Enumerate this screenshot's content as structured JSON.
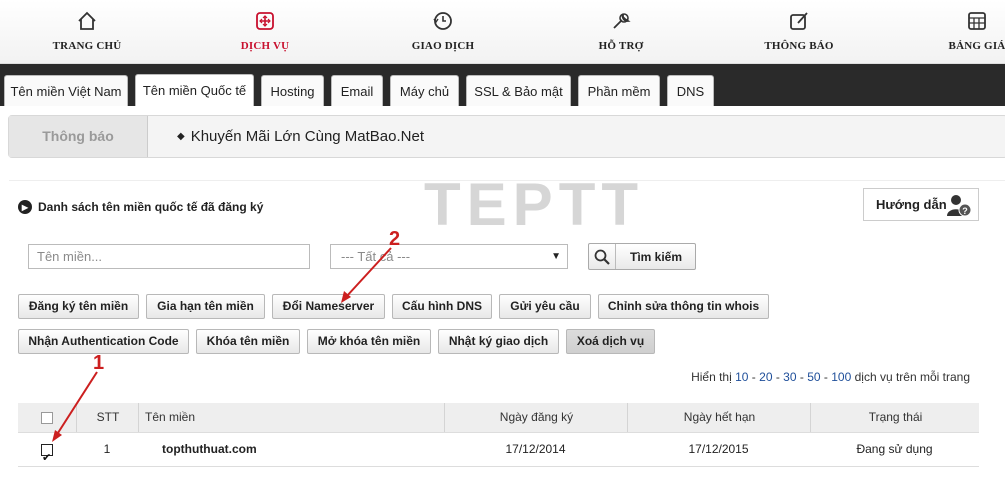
{
  "nav": [
    {
      "label": "TRANG CHỦ",
      "icon": "home-icon"
    },
    {
      "label": "DỊCH VỤ",
      "icon": "services-icon",
      "active": true
    },
    {
      "label": "GIAO DỊCH",
      "icon": "transaction-icon"
    },
    {
      "label": "HỖ TRỢ",
      "icon": "wrench-icon"
    },
    {
      "label": "THÔNG BÁO",
      "icon": "notification-icon"
    },
    {
      "label": "BẢNG GIÁ",
      "icon": "pricing-icon"
    }
  ],
  "tabs": [
    {
      "label": "Tên miền Việt Nam"
    },
    {
      "label": "Tên miền Quốc tế",
      "active": true
    },
    {
      "label": "Hosting"
    },
    {
      "label": "Email"
    },
    {
      "label": "Máy chủ"
    },
    {
      "label": "SSL & Bảo mật"
    },
    {
      "label": "Phần mềm"
    },
    {
      "label": "DNS"
    }
  ],
  "notice": {
    "label": "Thông báo",
    "text": "Khuyến Mãi Lớn Cùng MatBao.Net"
  },
  "watermark": "TEPTT",
  "section": {
    "title": "Danh sách tên miền quốc tế đã đăng ký",
    "guide_label": "Hướng dẫn"
  },
  "search": {
    "placeholder": "Tên miền...",
    "select_value": "--- Tất cả ---",
    "button_label": "Tìm kiếm"
  },
  "actions_row1": [
    "Đăng ký tên miền",
    "Gia hạn tên miền",
    "Đổi Nameserver",
    "Cấu hình DNS",
    "Gửi yêu cầu",
    "Chỉnh sửa thông tin whois"
  ],
  "actions_row2": [
    "Nhận Authentication Code",
    "Khóa tên miền",
    "Mở khóa tên miền",
    "Nhật ký giao dịch",
    "Xoá dịch vụ"
  ],
  "perpage": {
    "prefix": "Hiển thị",
    "options": [
      "10",
      "20",
      "30",
      "50",
      "100"
    ],
    "suffix": "dịch vụ trên mỗi trang"
  },
  "table": {
    "headers": {
      "stt": "STT",
      "domain": "Tên miền",
      "reg": "Ngày đăng ký",
      "exp": "Ngày hết hạn",
      "status": "Trạng thái"
    },
    "rows": [
      {
        "checked": true,
        "stt": "1",
        "domain": "topthuthuat.com",
        "reg": "17/12/2014",
        "exp": "17/12/2015",
        "status": "Đang sử dụng"
      }
    ]
  },
  "annotations": {
    "one": "1",
    "two": "2",
    "color": "#cc1f1f"
  },
  "colors": {
    "accent": "#c8102e",
    "tabbar": "#2a2a2a",
    "link": "#1f4f9a"
  }
}
